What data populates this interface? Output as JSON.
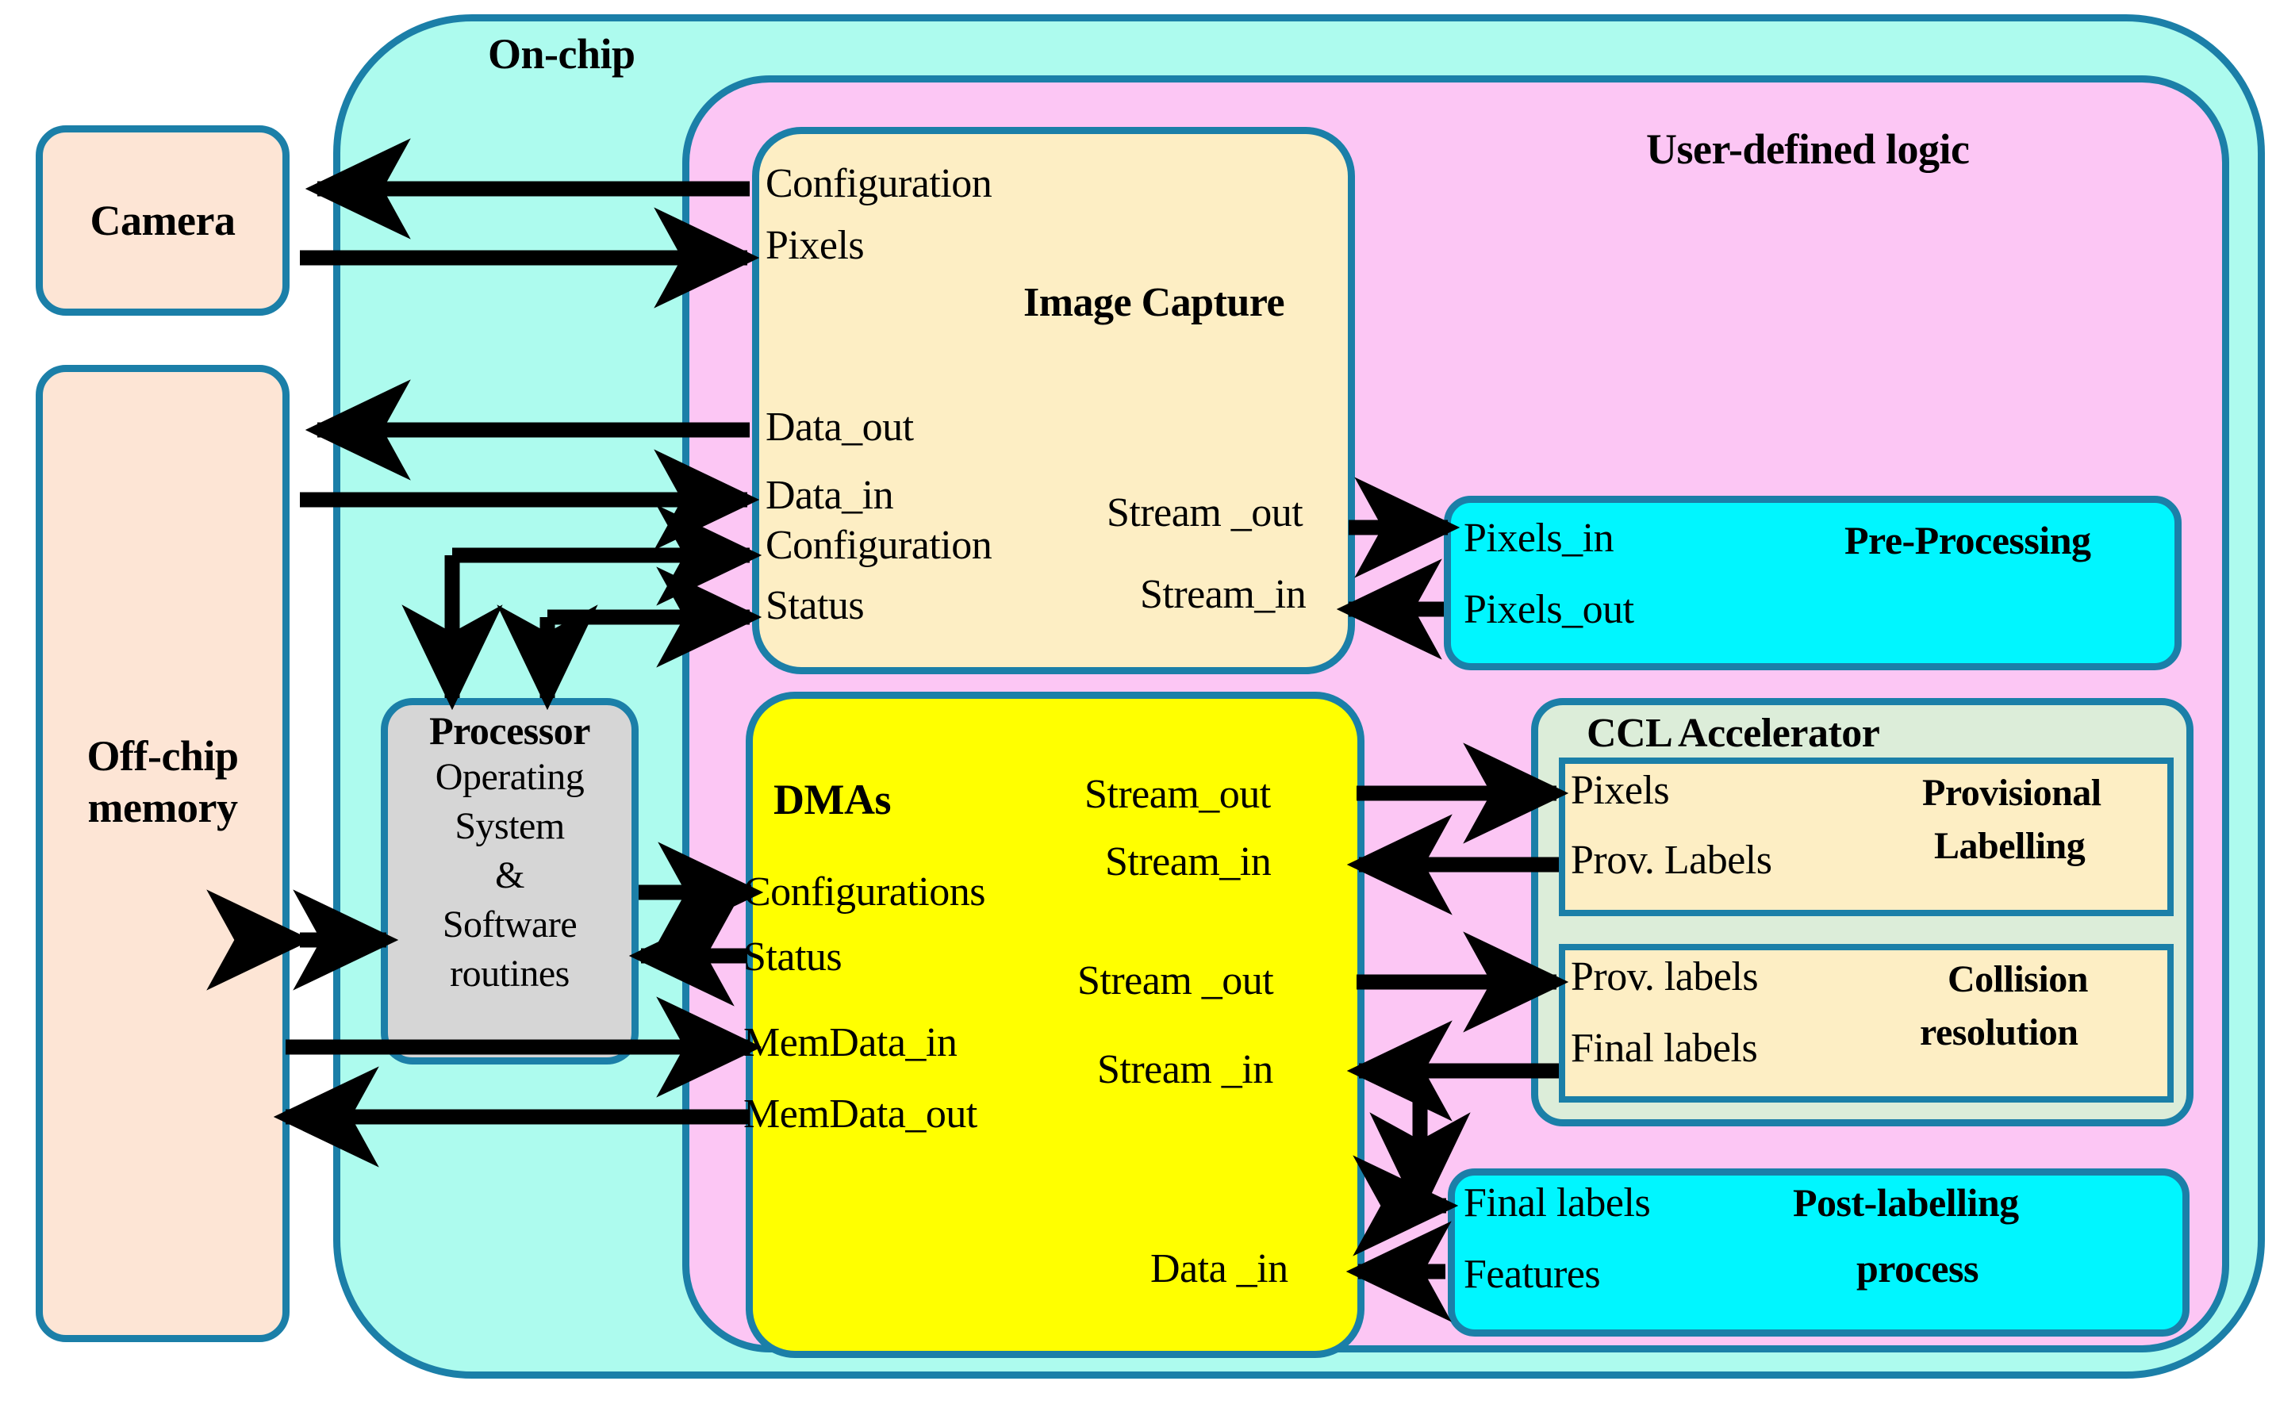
{
  "diagram": {
    "title_onchip": "On-chip",
    "title_userlogic": "User-defined logic"
  },
  "blocks": {
    "camera": {
      "title": "Camera"
    },
    "offchip_memory": {
      "title_line1": "Off-chip",
      "title_line2": "memory"
    },
    "processor": {
      "title": "Processor",
      "body_line1": "Operating",
      "body_line2": "System",
      "body_line3": "&",
      "body_line4": "Software",
      "body_line5": "routines"
    },
    "image_capture": {
      "title": "Image Capture",
      "ports_left": [
        "Configuration",
        "Pixels",
        "Data_out",
        "Data_in",
        "Configuration",
        "Status"
      ],
      "ports_right": [
        "Stream _out",
        "Stream_in"
      ]
    },
    "dmas": {
      "title": "DMAs",
      "ports_left": [
        "Configurations",
        "Status",
        "MemData_in",
        "MemData_out"
      ],
      "ports_right": [
        "Stream_out",
        "Stream_in",
        "Stream _out",
        "Stream _in",
        "Data _in"
      ]
    },
    "pre_processing": {
      "title": "Pre-Processing",
      "ports_left": [
        "Pixels_in",
        "Pixels_out"
      ]
    },
    "ccl_accelerator": {
      "title": "CCL Accelerator",
      "provisional_labelling": {
        "title_line1": "Provisional",
        "title_line2": "Labelling",
        "ports_left": [
          "Pixels",
          "Prov. Labels"
        ]
      },
      "collision_resolution": {
        "title_line1": "Collision",
        "title_line2": "resolution",
        "ports_left": [
          "Prov. labels",
          "Final labels"
        ]
      }
    },
    "post_labelling": {
      "title_line1": "Post-labelling",
      "title_line2": "process",
      "ports_left": [
        "Final labels",
        "Features"
      ]
    }
  },
  "colors": {
    "border": "#1b7fa8",
    "onchip_fill": "#adfbee",
    "userlogic_fill": "#fcc6f4",
    "external_fill": "#fde5d5",
    "processor_fill": "#d6d6d6",
    "capture_fill": "#fdeec4",
    "dma_fill": "#ffff00",
    "cyan_fill": "#00f6ff",
    "ccl_fill": "#dcedd9",
    "arrow": "#000000"
  }
}
